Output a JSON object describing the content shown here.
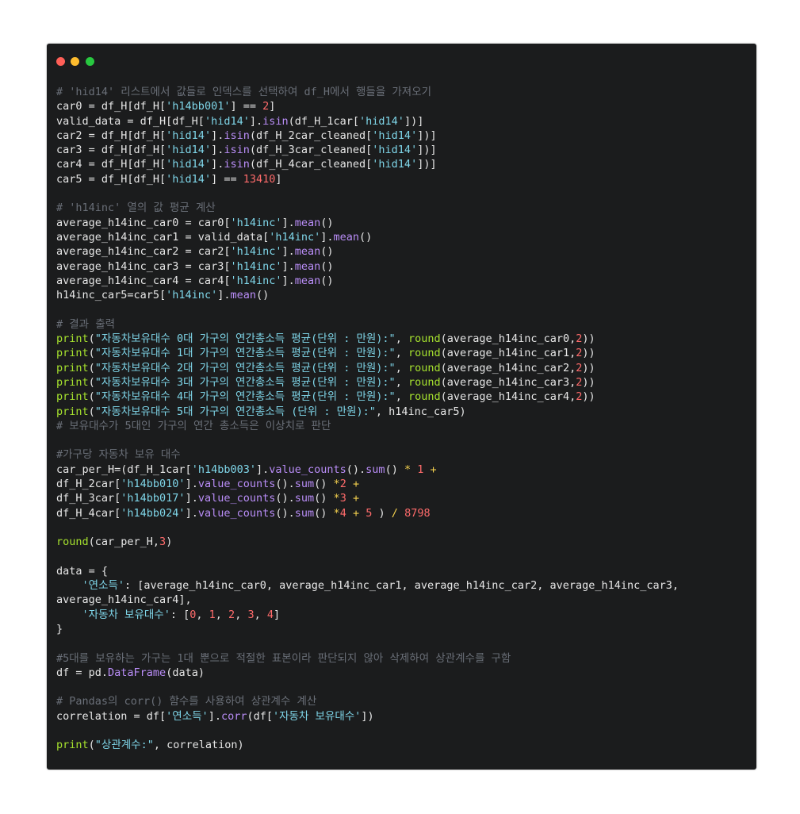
{
  "window": {
    "buttons": [
      "close",
      "minimize",
      "maximize"
    ]
  },
  "code": {
    "lines": [
      [
        [
          "# 'hid14' 리스트에서 값들로 인덱스를 선택하여 df_H에서 행들을 가져오기",
          "com"
        ]
      ],
      [
        [
          "car0 = df_H[df_H[",
          "def"
        ],
        [
          "'h14bb001'",
          "str"
        ],
        [
          "] == ",
          "def"
        ],
        [
          "2",
          "num"
        ],
        [
          "]",
          "def"
        ]
      ],
      [
        [
          "valid_data = df_H[df_H[",
          "def"
        ],
        [
          "'hid14'",
          "str"
        ],
        [
          "].",
          "def"
        ],
        [
          "isin",
          "meth"
        ],
        [
          "(df_H_1car[",
          "def"
        ],
        [
          "'hid14'",
          "str"
        ],
        [
          "])]",
          "def"
        ]
      ],
      [
        [
          "car2 = df_H[df_H[",
          "def"
        ],
        [
          "'hid14'",
          "str"
        ],
        [
          "].",
          "def"
        ],
        [
          "isin",
          "meth"
        ],
        [
          "(df_H_2car_cleaned[",
          "def"
        ],
        [
          "'hid14'",
          "str"
        ],
        [
          "])]",
          "def"
        ]
      ],
      [
        [
          "car3 = df_H[df_H[",
          "def"
        ],
        [
          "'hid14'",
          "str"
        ],
        [
          "].",
          "def"
        ],
        [
          "isin",
          "meth"
        ],
        [
          "(df_H_3car_cleaned[",
          "def"
        ],
        [
          "'hid14'",
          "str"
        ],
        [
          "])]",
          "def"
        ]
      ],
      [
        [
          "car4 = df_H[df_H[",
          "def"
        ],
        [
          "'hid14'",
          "str"
        ],
        [
          "].",
          "def"
        ],
        [
          "isin",
          "meth"
        ],
        [
          "(df_H_4car_cleaned[",
          "def"
        ],
        [
          "'hid14'",
          "str"
        ],
        [
          "])]",
          "def"
        ]
      ],
      [
        [
          "car5 = df_H[df_H[",
          "def"
        ],
        [
          "'hid14'",
          "str"
        ],
        [
          "] == ",
          "def"
        ],
        [
          "13410",
          "num"
        ],
        [
          "]",
          "def"
        ]
      ],
      [],
      [
        [
          "# 'h14inc' 열의 값 평균 계산",
          "com"
        ]
      ],
      [
        [
          "average_h14inc_car0 = car0[",
          "def"
        ],
        [
          "'h14inc'",
          "str"
        ],
        [
          "].",
          "def"
        ],
        [
          "mean",
          "meth"
        ],
        [
          "()",
          "def"
        ]
      ],
      [
        [
          "average_h14inc_car1 = valid_data[",
          "def"
        ],
        [
          "'h14inc'",
          "str"
        ],
        [
          "].",
          "def"
        ],
        [
          "mean",
          "meth"
        ],
        [
          "()",
          "def"
        ]
      ],
      [
        [
          "average_h14inc_car2 = car2[",
          "def"
        ],
        [
          "'h14inc'",
          "str"
        ],
        [
          "].",
          "def"
        ],
        [
          "mean",
          "meth"
        ],
        [
          "()",
          "def"
        ]
      ],
      [
        [
          "average_h14inc_car3 = car3[",
          "def"
        ],
        [
          "'h14inc'",
          "str"
        ],
        [
          "].",
          "def"
        ],
        [
          "mean",
          "meth"
        ],
        [
          "()",
          "def"
        ]
      ],
      [
        [
          "average_h14inc_car4 = car4[",
          "def"
        ],
        [
          "'h14inc'",
          "str"
        ],
        [
          "].",
          "def"
        ],
        [
          "mean",
          "meth"
        ],
        [
          "()",
          "def"
        ]
      ],
      [
        [
          "h14inc_car5=car5[",
          "def"
        ],
        [
          "'h14inc'",
          "str"
        ],
        [
          "].",
          "def"
        ],
        [
          "mean",
          "meth"
        ],
        [
          "()",
          "def"
        ]
      ],
      [],
      [
        [
          "# 결과 출력",
          "com"
        ]
      ],
      [
        [
          "print",
          "func"
        ],
        [
          "(",
          "def"
        ],
        [
          "\"자동차보유대수 0대 가구의 연간총소득 평균(단위 : 만원):\"",
          "str"
        ],
        [
          ", ",
          "def"
        ],
        [
          "round",
          "func"
        ],
        [
          "(average_h14inc_car0,",
          "def"
        ],
        [
          "2",
          "num"
        ],
        [
          "))",
          "def"
        ]
      ],
      [
        [
          "print",
          "func"
        ],
        [
          "(",
          "def"
        ],
        [
          "\"자동차보유대수 1대 가구의 연간총소득 평균(단위 : 만원):\"",
          "str"
        ],
        [
          ", ",
          "def"
        ],
        [
          "round",
          "func"
        ],
        [
          "(average_h14inc_car1,",
          "def"
        ],
        [
          "2",
          "num"
        ],
        [
          "))",
          "def"
        ]
      ],
      [
        [
          "print",
          "func"
        ],
        [
          "(",
          "def"
        ],
        [
          "\"자동차보유대수 2대 가구의 연간총소득 평균(단위 : 만원):\"",
          "str"
        ],
        [
          ", ",
          "def"
        ],
        [
          "round",
          "func"
        ],
        [
          "(average_h14inc_car2,",
          "def"
        ],
        [
          "2",
          "num"
        ],
        [
          "))",
          "def"
        ]
      ],
      [
        [
          "print",
          "func"
        ],
        [
          "(",
          "def"
        ],
        [
          "\"자동차보유대수 3대 가구의 연간총소득 평균(단위 : 만원):\"",
          "str"
        ],
        [
          ", ",
          "def"
        ],
        [
          "round",
          "func"
        ],
        [
          "(average_h14inc_car3,",
          "def"
        ],
        [
          "2",
          "num"
        ],
        [
          "))",
          "def"
        ]
      ],
      [
        [
          "print",
          "func"
        ],
        [
          "(",
          "def"
        ],
        [
          "\"자동차보유대수 4대 가구의 연간총소득 평균(단위 : 만원):\"",
          "str"
        ],
        [
          ", ",
          "def"
        ],
        [
          "round",
          "func"
        ],
        [
          "(average_h14inc_car4,",
          "def"
        ],
        [
          "2",
          "num"
        ],
        [
          "))",
          "def"
        ]
      ],
      [
        [
          "print",
          "func"
        ],
        [
          "(",
          "def"
        ],
        [
          "\"자동차보유대수 5대 가구의 연간총소득 (단위 : 만원):\"",
          "str"
        ],
        [
          ", h14inc_car5)",
          "def"
        ]
      ],
      [
        [
          "# 보유대수가 5대인 가구의 연간 총소득은 이상치로 판단",
          "com"
        ]
      ],
      [],
      [
        [
          "#가구당 자동차 보유 대수",
          "com"
        ]
      ],
      [
        [
          "car_per_H=(df_H_1car[",
          "def"
        ],
        [
          "'h14bb003'",
          "str"
        ],
        [
          "].",
          "def"
        ],
        [
          "value_counts",
          "meth"
        ],
        [
          "().",
          "def"
        ],
        [
          "sum",
          "meth"
        ],
        [
          "() ",
          "def"
        ],
        [
          "*",
          "op"
        ],
        [
          " ",
          "def"
        ],
        [
          "1",
          "num"
        ],
        [
          " ",
          "def"
        ],
        [
          "+",
          "op"
        ]
      ],
      [
        [
          "df_H_2car[",
          "def"
        ],
        [
          "'h14bb010'",
          "str"
        ],
        [
          "].",
          "def"
        ],
        [
          "value_counts",
          "meth"
        ],
        [
          "().",
          "def"
        ],
        [
          "sum",
          "meth"
        ],
        [
          "() ",
          "def"
        ],
        [
          "*",
          "op"
        ],
        [
          "2",
          "num"
        ],
        [
          " ",
          "def"
        ],
        [
          "+",
          "op"
        ]
      ],
      [
        [
          "df_H_3car[",
          "def"
        ],
        [
          "'h14bb017'",
          "str"
        ],
        [
          "].",
          "def"
        ],
        [
          "value_counts",
          "meth"
        ],
        [
          "().",
          "def"
        ],
        [
          "sum",
          "meth"
        ],
        [
          "() ",
          "def"
        ],
        [
          "*",
          "op"
        ],
        [
          "3",
          "num"
        ],
        [
          " ",
          "def"
        ],
        [
          "+",
          "op"
        ]
      ],
      [
        [
          "df_H_4car[",
          "def"
        ],
        [
          "'h14bb024'",
          "str"
        ],
        [
          "].",
          "def"
        ],
        [
          "value_counts",
          "meth"
        ],
        [
          "().",
          "def"
        ],
        [
          "sum",
          "meth"
        ],
        [
          "() ",
          "def"
        ],
        [
          "*",
          "op"
        ],
        [
          "4",
          "num"
        ],
        [
          " ",
          "def"
        ],
        [
          "+",
          "op"
        ],
        [
          " ",
          "def"
        ],
        [
          "5",
          "num"
        ],
        [
          " ) ",
          "def"
        ],
        [
          "/",
          "op"
        ],
        [
          " ",
          "def"
        ],
        [
          "8798",
          "num"
        ]
      ],
      [],
      [
        [
          "round",
          "func"
        ],
        [
          "(car_per_H,",
          "def"
        ],
        [
          "3",
          "num"
        ],
        [
          ")",
          "def"
        ]
      ],
      [],
      [
        [
          "data = {",
          "def"
        ]
      ],
      [
        [
          "    ",
          "def"
        ],
        [
          "'연소득'",
          "str"
        ],
        [
          ": [average_h14inc_car0, average_h14inc_car1, average_h14inc_car2, average_h14inc_car3,",
          "def"
        ]
      ],
      [
        [
          "average_h14inc_car4],",
          "def"
        ]
      ],
      [
        [
          "    ",
          "def"
        ],
        [
          "'자동차 보유대수'",
          "str"
        ],
        [
          ": [",
          "def"
        ],
        [
          "0",
          "num"
        ],
        [
          ", ",
          "def"
        ],
        [
          "1",
          "num"
        ],
        [
          ", ",
          "def"
        ],
        [
          "2",
          "num"
        ],
        [
          ", ",
          "def"
        ],
        [
          "3",
          "num"
        ],
        [
          ", ",
          "def"
        ],
        [
          "4",
          "num"
        ],
        [
          "]",
          "def"
        ]
      ],
      [
        [
          "}",
          "def"
        ]
      ],
      [],
      [
        [
          "#5대를 보유하는 가구는 1대 뿐으로 적절한 표본이라 판단되지 않아 삭제하여 상관계수를 구함",
          "com"
        ]
      ],
      [
        [
          "df = pd.",
          "def"
        ],
        [
          "DataFrame",
          "meth"
        ],
        [
          "(data)",
          "def"
        ]
      ],
      [],
      [
        [
          "# Pandas의 corr() 함수를 사용하여 상관계수 계산",
          "com"
        ]
      ],
      [
        [
          "correlation = df[",
          "def"
        ],
        [
          "'연소득'",
          "str"
        ],
        [
          "].",
          "def"
        ],
        [
          "corr",
          "meth"
        ],
        [
          "(df[",
          "def"
        ],
        [
          "'자동차 보유대수'",
          "str"
        ],
        [
          "])",
          "def"
        ]
      ],
      [],
      [
        [
          "print",
          "func"
        ],
        [
          "(",
          "def"
        ],
        [
          "\"상관계수:\"",
          "str"
        ],
        [
          ", correlation)",
          "def"
        ]
      ]
    ]
  },
  "colors": {
    "background": "#1b1c1d",
    "default": "#e6e6e6",
    "string": "#7fd6e9",
    "number": "#ff6b6b",
    "operator": "#f3d04e",
    "comment": "#6a6f78",
    "method": "#b98df7",
    "function": "#a6e22e",
    "close": "#ff5f57",
    "minimize": "#febc2e",
    "maximize": "#28c840"
  }
}
